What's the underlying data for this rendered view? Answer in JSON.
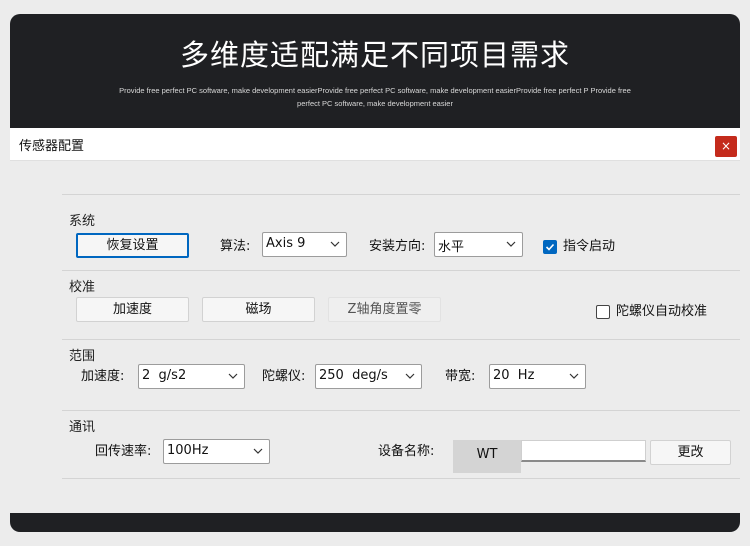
{
  "banner": {
    "title": "多维度适配满足不同项目需求",
    "subtitle": "Provide free perfect PC software, make development easierProvide free perfect PC software, make development easierProvide free perfect P Provide free perfect PC software, make development easier"
  },
  "dialog": {
    "title": "传感器配置",
    "close_symbol": "×"
  },
  "system": {
    "title": "系统",
    "restore_button": "恢复设置",
    "algorithm_label": "算法:",
    "algorithm_value": "Axis 9",
    "install_dir_label": "安装方向:",
    "install_dir_value": "水平",
    "command_start_label": "指令启动",
    "command_start_checked": true
  },
  "calibration": {
    "title": "校准",
    "accel_button": "加速度",
    "mag_button": "磁场",
    "z_zero_button": "Z轴角度置零",
    "gyro_auto_label": "陀螺仪自动校准",
    "gyro_auto_checked": false
  },
  "range": {
    "title": "范围",
    "accel_label": "加速度:",
    "accel_value": "2  g/s2",
    "gyro_label": "陀螺仪:",
    "gyro_value": "250  deg/s",
    "bandwidth_label": "带宽:",
    "bandwidth_value": "20  Hz"
  },
  "comm": {
    "title": "通讯",
    "rate_label": "回传速率:",
    "rate_value": "100Hz",
    "device_name_label": "设备名称:",
    "device_prefix": "WT",
    "device_name_value": "",
    "change_button": "更改"
  },
  "colors": {
    "accent": "#0067c0",
    "close": "#c42b1c",
    "banner_bg": "#1f2023"
  },
  "icons": [
    "chevron-down-icon",
    "close-icon",
    "checkmark-icon"
  ]
}
